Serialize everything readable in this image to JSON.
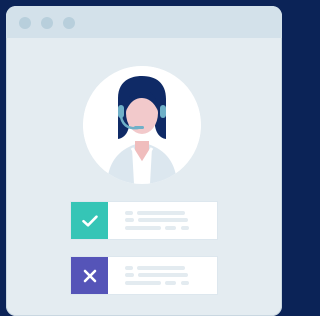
{
  "window": {
    "controls": [
      "window-dot-1",
      "window-dot-2",
      "window-dot-3"
    ]
  },
  "avatar": {
    "icon": "support-agent-avatar-icon"
  },
  "status_rows": [
    {
      "status": "success",
      "icon": "check-icon",
      "color": "#35c5b6"
    },
    {
      "status": "fail",
      "icon": "close-icon",
      "color": "#5554b8"
    }
  ],
  "colors": {
    "background": "#0b2357",
    "window": "#e4ecf1",
    "titlebar": "#d3e1ea",
    "skin": "#f2c9cb",
    "hair": "#0f2a66"
  }
}
